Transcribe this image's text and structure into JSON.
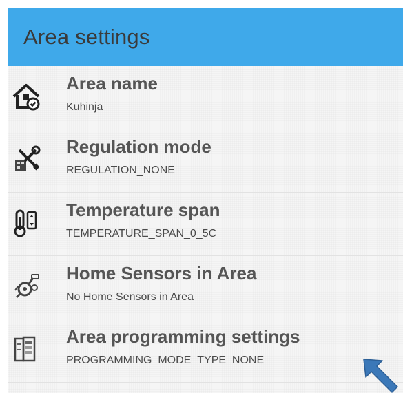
{
  "header": {
    "title": "Area settings"
  },
  "items": [
    {
      "label": "Area name",
      "value": "Kuhinja",
      "icon": "home-settings-icon"
    },
    {
      "label": "Regulation mode",
      "value": "REGULATION_NONE",
      "icon": "tools-icon"
    },
    {
      "label": "Temperature span",
      "value": "TEMPERATURE_SPAN_0_5C",
      "icon": "thermometer-icon"
    },
    {
      "label": "Home Sensors in Area",
      "value": "No Home Sensors in Area",
      "icon": "sensor-icon"
    },
    {
      "label": "Area programming settings",
      "value": "PROGRAMMING_MODE_TYPE_NONE",
      "icon": "programming-icon"
    }
  ],
  "colors": {
    "header": "#3fa9ea",
    "arrow": "#3b78b8"
  }
}
